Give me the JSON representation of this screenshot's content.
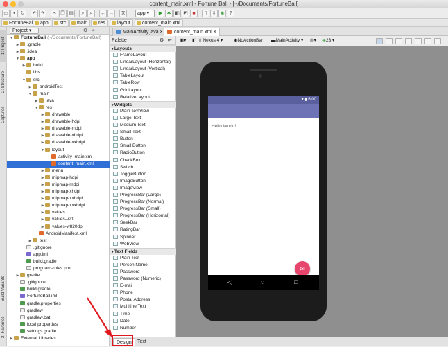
{
  "window": {
    "title": "content_main.xml - Fortune Ball - [~/Documents/FortuneBall]"
  },
  "toolbar": {
    "run_config": "app"
  },
  "breadcrumbs": [
    "FortuneBall",
    "app",
    "src",
    "main",
    "res",
    "layout",
    "content_main.xml"
  ],
  "left_strip": {
    "tabs": [
      "1: Project",
      "2: Structure",
      "Captures",
      "Build Variants",
      "2: Favorites"
    ]
  },
  "project_pane": {
    "selector": "Project",
    "tree": [
      {
        "label": "FortuneBall",
        "suffix": "(~/Documents/FortuneBall)",
        "indent": 0,
        "icon": "folder",
        "open": true,
        "bold": true
      },
      {
        "label": ".gradle",
        "indent": 1,
        "icon": "folder",
        "open": false
      },
      {
        "label": ".idea",
        "indent": 1,
        "icon": "folder",
        "open": false
      },
      {
        "label": "app",
        "indent": 1,
        "icon": "folder",
        "open": true,
        "bold": true
      },
      {
        "label": "build",
        "indent": 2,
        "icon": "folder",
        "open": false
      },
      {
        "label": "libs",
        "indent": 2,
        "icon": "folder",
        "leaf": true
      },
      {
        "label": "src",
        "indent": 2,
        "icon": "folder",
        "open": true
      },
      {
        "label": "androidTest",
        "indent": 3,
        "icon": "folder",
        "open": false
      },
      {
        "label": "main",
        "indent": 3,
        "icon": "folder",
        "open": true
      },
      {
        "label": "java",
        "indent": 4,
        "icon": "folder",
        "open": false
      },
      {
        "label": "res",
        "indent": 4,
        "icon": "folder",
        "open": true
      },
      {
        "label": "drawable",
        "indent": 5,
        "icon": "folder",
        "open": false
      },
      {
        "label": "drawable-hdpi",
        "indent": 5,
        "icon": "folder",
        "open": false
      },
      {
        "label": "drawable-mdpi",
        "indent": 5,
        "icon": "folder",
        "open": false
      },
      {
        "label": "drawable-xhdpi",
        "indent": 5,
        "icon": "folder",
        "open": false
      },
      {
        "label": "drawable-xxhdpi",
        "indent": 5,
        "icon": "folder",
        "open": false
      },
      {
        "label": "layout",
        "indent": 5,
        "icon": "folder",
        "open": true
      },
      {
        "label": "activity_main.xml",
        "indent": 6,
        "icon": "xml",
        "leaf": true
      },
      {
        "label": "content_main.xml",
        "indent": 6,
        "icon": "xml",
        "leaf": true,
        "selected": true
      },
      {
        "label": "menu",
        "indent": 5,
        "icon": "folder",
        "open": false
      },
      {
        "label": "mipmap-hdpi",
        "indent": 5,
        "icon": "folder",
        "open": false
      },
      {
        "label": "mipmap-mdpi",
        "indent": 5,
        "icon": "folder",
        "open": false
      },
      {
        "label": "mipmap-xhdpi",
        "indent": 5,
        "icon": "folder",
        "open": false
      },
      {
        "label": "mipmap-xxhdpi",
        "indent": 5,
        "icon": "folder",
        "open": false
      },
      {
        "label": "mipmap-xxxhdpi",
        "indent": 5,
        "icon": "folder",
        "open": false
      },
      {
        "label": "values",
        "indent": 5,
        "icon": "folder",
        "open": false
      },
      {
        "label": "values-v21",
        "indent": 5,
        "icon": "folder",
        "open": false
      },
      {
        "label": "values-w820dp",
        "indent": 5,
        "icon": "folder",
        "open": false
      },
      {
        "label": "AndroidManifest.xml",
        "indent": 4,
        "icon": "xml",
        "leaf": true
      },
      {
        "label": "test",
        "indent": 3,
        "icon": "folder",
        "open": false
      },
      {
        "label": ".gitignore",
        "indent": 2,
        "icon": "file",
        "leaf": true
      },
      {
        "label": "app.iml",
        "indent": 2,
        "icon": "iml",
        "leaf": true
      },
      {
        "label": "build.gradle",
        "indent": 2,
        "icon": "gradle",
        "leaf": true
      },
      {
        "label": "proguard-rules.pro",
        "indent": 2,
        "icon": "file",
        "leaf": true
      },
      {
        "label": "gradle",
        "indent": 1,
        "icon": "folder",
        "open": false
      },
      {
        "label": ".gitignore",
        "indent": 1,
        "icon": "file",
        "leaf": true
      },
      {
        "label": "build.gradle",
        "indent": 1,
        "icon": "gradle",
        "leaf": true
      },
      {
        "label": "FortuneBall.iml",
        "indent": 1,
        "icon": "iml",
        "leaf": true
      },
      {
        "label": "gradle.properties",
        "indent": 1,
        "icon": "gradle",
        "leaf": true
      },
      {
        "label": "gradlew",
        "indent": 1,
        "icon": "file",
        "leaf": true
      },
      {
        "label": "gradlew.bat",
        "indent": 1,
        "icon": "file",
        "leaf": true
      },
      {
        "label": "local.properties",
        "indent": 1,
        "icon": "gradle",
        "leaf": true
      },
      {
        "label": "settings.gradle",
        "indent": 1,
        "icon": "gradle",
        "leaf": true
      },
      {
        "label": "External Libraries",
        "indent": 0,
        "icon": "folder",
        "open": false
      }
    ]
  },
  "editor_tabs": [
    {
      "label": "MainActivity.java",
      "active": false
    },
    {
      "label": "content_main.xml",
      "active": true
    }
  ],
  "palette": {
    "title": "Palette",
    "items": [
      {
        "label": "Layouts",
        "category": true
      },
      {
        "label": "FrameLayout"
      },
      {
        "label": "LinearLayout (Horizontal)"
      },
      {
        "label": "LinearLayout (Vertical)"
      },
      {
        "label": "TableLayout"
      },
      {
        "label": "TableRow"
      },
      {
        "label": "GridLayout"
      },
      {
        "label": "RelativeLayout"
      },
      {
        "label": "Widgets",
        "category": true
      },
      {
        "label": "Plain TextView"
      },
      {
        "label": "Large Text"
      },
      {
        "label": "Medium Text"
      },
      {
        "label": "Small Text"
      },
      {
        "label": "Button"
      },
      {
        "label": "Small Button"
      },
      {
        "label": "RadioButton"
      },
      {
        "label": "CheckBox"
      },
      {
        "label": "Switch"
      },
      {
        "label": "ToggleButton"
      },
      {
        "label": "ImageButton"
      },
      {
        "label": "ImageView"
      },
      {
        "label": "ProgressBar (Large)"
      },
      {
        "label": "ProgressBar (Normal)"
      },
      {
        "label": "ProgressBar (Small)"
      },
      {
        "label": "ProgressBar (Horizontal)"
      },
      {
        "label": "SeekBar"
      },
      {
        "label": "RatingBar"
      },
      {
        "label": "Spinner"
      },
      {
        "label": "WebView"
      },
      {
        "label": "Text Fields",
        "category": true
      },
      {
        "label": "Plain Text"
      },
      {
        "label": "Person Name"
      },
      {
        "label": "Password"
      },
      {
        "label": "Password (Numeric)"
      },
      {
        "label": "E-mail"
      },
      {
        "label": "Phone"
      },
      {
        "label": "Postal Address"
      },
      {
        "label": "Multiline Text"
      },
      {
        "label": "Time"
      },
      {
        "label": "Date"
      },
      {
        "label": "Number"
      }
    ]
  },
  "design_toolbar": {
    "device": "Nexus 4",
    "theme": "NoActionBar",
    "activity": "MainActivity",
    "api": "23"
  },
  "device_preview": {
    "status_time": "6:00",
    "hello_text": "Hello World!",
    "fab_icon": "mail-icon",
    "nav_icons": [
      "back-icon",
      "home-icon",
      "recents-icon"
    ]
  },
  "bottom_tabs": [
    {
      "label": "Design",
      "active": true
    },
    {
      "label": "Text",
      "active": false
    }
  ],
  "colors": {
    "selection": "#2f6fd6",
    "status_bar": "#5a5f9e",
    "app_bar": "#6d73b4",
    "fab": "#e8456c",
    "highlight": "#e0181e"
  }
}
